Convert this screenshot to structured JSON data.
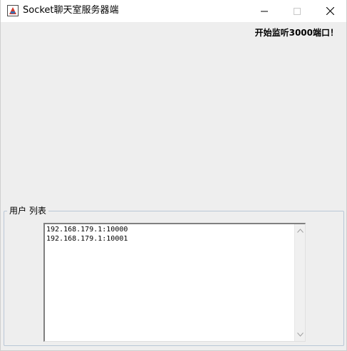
{
  "window": {
    "title": "Socket聊天室服务器端",
    "icons": {
      "app": "java-app-icon",
      "minimize": "minimize-icon",
      "maximize": "maximize-icon",
      "close": "close-icon"
    }
  },
  "status": {
    "text": "开始监听3000端口！"
  },
  "users_panel": {
    "legend": "用户 列表",
    "items": [
      "192.168.179.1:10000",
      "192.168.179.1:10001"
    ]
  }
}
